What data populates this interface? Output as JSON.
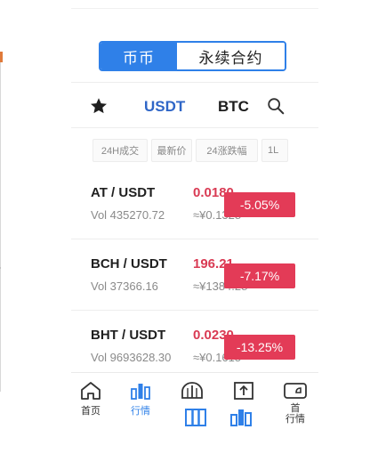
{
  "segment": {
    "spot": "币币",
    "perpetual": "永续合约"
  },
  "tabs": {
    "usdt": "USDT",
    "btc": "BTC"
  },
  "sort": {
    "vol24h": "24H成交",
    "latest": "最新价",
    "change24h": "24涨跌幅",
    "more": "1L"
  },
  "rows": [
    {
      "pair": "AT / USDT",
      "vol": "Vol  435270.72",
      "price": "0.0180",
      "cny": "≈¥0.1328",
      "change": "-5.05%"
    },
    {
      "pair": "BCH / USDT",
      "vol": "Vol  37366.16",
      "price": "196.21",
      "cny": "≈¥1384.28",
      "change": "-7.17%"
    },
    {
      "pair": "BHT / USDT",
      "vol": "Vol  9693628.30",
      "price": "0.0230",
      "cny": "≈¥0.1615",
      "change": "-13.25%"
    }
  ],
  "nav": {
    "home": "首页",
    "market": "行情",
    "market2": "行情",
    "extra_top": "首"
  },
  "colors": {
    "accent": "#2f80e8",
    "down": "#e33b57"
  }
}
